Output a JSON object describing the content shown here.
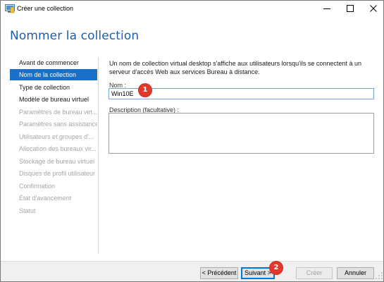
{
  "window": {
    "title": "Créer une collection",
    "icon": "server-manager-icon"
  },
  "title_buttons": {
    "minimize": "—",
    "maximize": "☐",
    "close": "✕"
  },
  "page": {
    "heading": "Nommer la collection"
  },
  "nav": {
    "items": [
      {
        "label": "Avant de commencer",
        "state": "normal"
      },
      {
        "label": "Nom de la collection",
        "state": "selected"
      },
      {
        "label": "Type de collection",
        "state": "normal"
      },
      {
        "label": "Modèle de bureau virtuel",
        "state": "normal"
      },
      {
        "label": "Paramètres de bureau virt...",
        "state": "disabled"
      },
      {
        "label": "Paramètres sans assistance",
        "state": "disabled"
      },
      {
        "label": "Utilisateurs et groupes d'...",
        "state": "disabled"
      },
      {
        "label": "Allocation des bureaux vir...",
        "state": "disabled"
      },
      {
        "label": "Stockage de bureau virtuel",
        "state": "disabled"
      },
      {
        "label": "Disques de profil utilisateur",
        "state": "disabled"
      },
      {
        "label": "Confirmation",
        "state": "disabled"
      },
      {
        "label": "État d'avancement",
        "state": "disabled"
      },
      {
        "label": "Statut",
        "state": "disabled"
      }
    ]
  },
  "main": {
    "intro": "Un nom de collection virtual desktop s'affiche aux utilisateurs lorsqu'ils se connectent à un serveur d'accès Web aux services Bureau à distance.",
    "name_label": "Nom :",
    "name_value": "Win10E",
    "description_label": "Description (facultative) :",
    "description_value": ""
  },
  "annotations": {
    "badge1": "1",
    "badge2": "2",
    "color": "#e0392b"
  },
  "buttons": {
    "previous": "< Précédent",
    "next": "Suivant >",
    "create": "Créer",
    "cancel": "Annuler"
  },
  "colors": {
    "heading": "#1e5fa8",
    "selected_nav": "#1a70c8",
    "disabled_text": "#a6a6a6"
  }
}
